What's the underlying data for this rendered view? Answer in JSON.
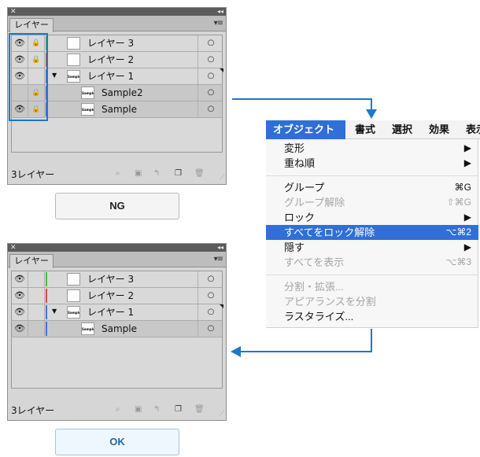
{
  "panels": [
    {
      "tab": "レイヤー",
      "layer_count": "3レイヤー",
      "rows": [
        {
          "name": "レイヤー 3",
          "eye": true,
          "lock": true,
          "color": "#3cc43c",
          "type": "layer"
        },
        {
          "name": "レイヤー 2",
          "eye": true,
          "lock": true,
          "color": "#d94848",
          "type": "layer"
        },
        {
          "name": "レイヤー 1",
          "eye": true,
          "lock": false,
          "color": "#4a6ee0",
          "type": "layer-expanded",
          "thumb": "Sample"
        },
        {
          "name": "Sample2",
          "eye": false,
          "lock": true,
          "color": "#4a6ee0",
          "type": "sublayer",
          "thumb": "Sample"
        },
        {
          "name": "Sample",
          "eye": true,
          "lock": true,
          "color": "#4a6ee0",
          "type": "sublayer",
          "thumb": "Sample"
        }
      ],
      "result_label": "NG"
    },
    {
      "tab": "レイヤー",
      "layer_count": "3レイヤー",
      "rows": [
        {
          "name": "レイヤー 3",
          "eye": true,
          "lock": false,
          "color": "#3cc43c",
          "type": "layer"
        },
        {
          "name": "レイヤー 2",
          "eye": true,
          "lock": false,
          "color": "#d94848",
          "type": "layer"
        },
        {
          "name": "レイヤー 1",
          "eye": true,
          "lock": false,
          "color": "#4a6ee0",
          "type": "layer-expanded",
          "thumb": "Sample"
        },
        {
          "name": "Sample",
          "eye": true,
          "lock": false,
          "color": "#4a6ee0",
          "type": "sublayer",
          "thumb": "Sample"
        }
      ],
      "result_label": "OK"
    }
  ],
  "menubar": {
    "items": [
      "オブジェクト",
      "書式",
      "選択",
      "効果",
      "表示"
    ],
    "active": "オブジェクト"
  },
  "menu": {
    "items": [
      {
        "label": "変形",
        "shortcut": "▶",
        "state": "normal"
      },
      {
        "label": "重ね順",
        "shortcut": "▶",
        "state": "normal"
      },
      {
        "label": "グループ",
        "shortcut": "⌘G",
        "state": "normal"
      },
      {
        "label": "グループ解除",
        "shortcut": "⇧⌘G",
        "state": "disabled"
      },
      {
        "label": "ロック",
        "shortcut": "▶",
        "state": "normal"
      },
      {
        "label": "すべてをロック解除",
        "shortcut": "⌥⌘2",
        "state": "highlight"
      },
      {
        "label": "隠す",
        "shortcut": "▶",
        "state": "normal"
      },
      {
        "label": "すべてを表示",
        "shortcut": "⌥⌘3",
        "state": "disabled"
      },
      {
        "label": "分割・拡張...",
        "shortcut": "",
        "state": "disabled"
      },
      {
        "label": "アピアランスを分割",
        "shortcut": "",
        "state": "disabled"
      },
      {
        "label": "ラスタライズ...",
        "shortcut": "",
        "state": "normal"
      }
    ]
  },
  "icons": {
    "eye": "eye-icon",
    "lock": "lock-icon",
    "target": "target-circle-icon",
    "footer": [
      "search-icon",
      "clipping-mask-icon",
      "new-sublayer-icon",
      "new-layer-icon",
      "trash-icon"
    ]
  },
  "colors": {
    "accent_blue": "#1e78c8",
    "menu_highlight": "#2f6fd6"
  }
}
